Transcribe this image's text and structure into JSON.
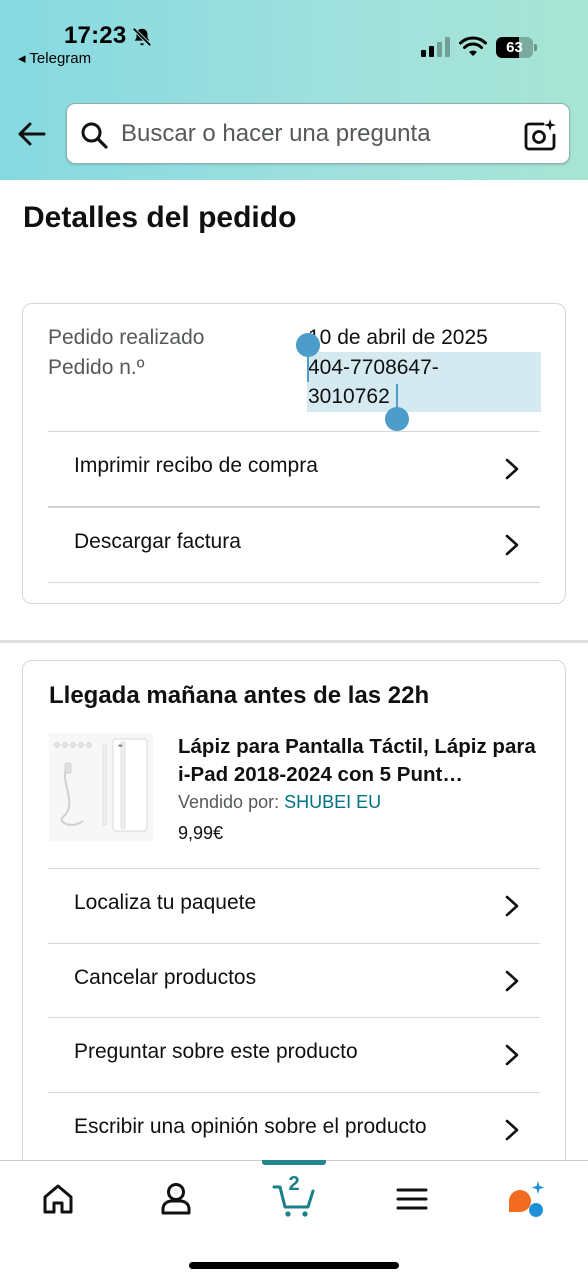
{
  "status_bar": {
    "time": "17:23",
    "back_app": "◂ Telegram",
    "battery": "63",
    "battery_level": 0.63
  },
  "header": {
    "search_placeholder": "Buscar o hacer una pregunta",
    "icons": [
      "back-arrow-icon",
      "search-icon",
      "camera-sparkle-icon"
    ]
  },
  "page": {
    "title": "Detalles del pedido"
  },
  "order": {
    "placed_label": "Pedido realizado",
    "placed_value": "10 de abril de 2025",
    "number_label": "Pedido n.º",
    "number_line1": "404-7708647-",
    "number_line2": "3010762",
    "actions": [
      {
        "label": "Imprimir recibo de compra"
      },
      {
        "label": "Descargar factura"
      }
    ]
  },
  "shipment": {
    "arrival": "Llegada mañana antes de las 22h",
    "product": {
      "title": "Lápiz para Pantalla Táctil, Lápiz para i-Pad 2018-2024 con 5 Punt…",
      "seller_label": "Vendido por: ",
      "seller_name": "SHUBEI EU",
      "price": "9,99€"
    },
    "actions": [
      {
        "label": "Localiza tu paquete"
      },
      {
        "label": "Cancelar productos"
      },
      {
        "label": "Preguntar sobre este producto"
      },
      {
        "label": "Escribir una opinión sobre el producto"
      }
    ]
  },
  "bottom_nav": {
    "cart_count": "2",
    "items": [
      "home-icon",
      "account-icon",
      "cart-icon",
      "menu-icon",
      "rufus-icon"
    ],
    "active": "cart-icon"
  }
}
